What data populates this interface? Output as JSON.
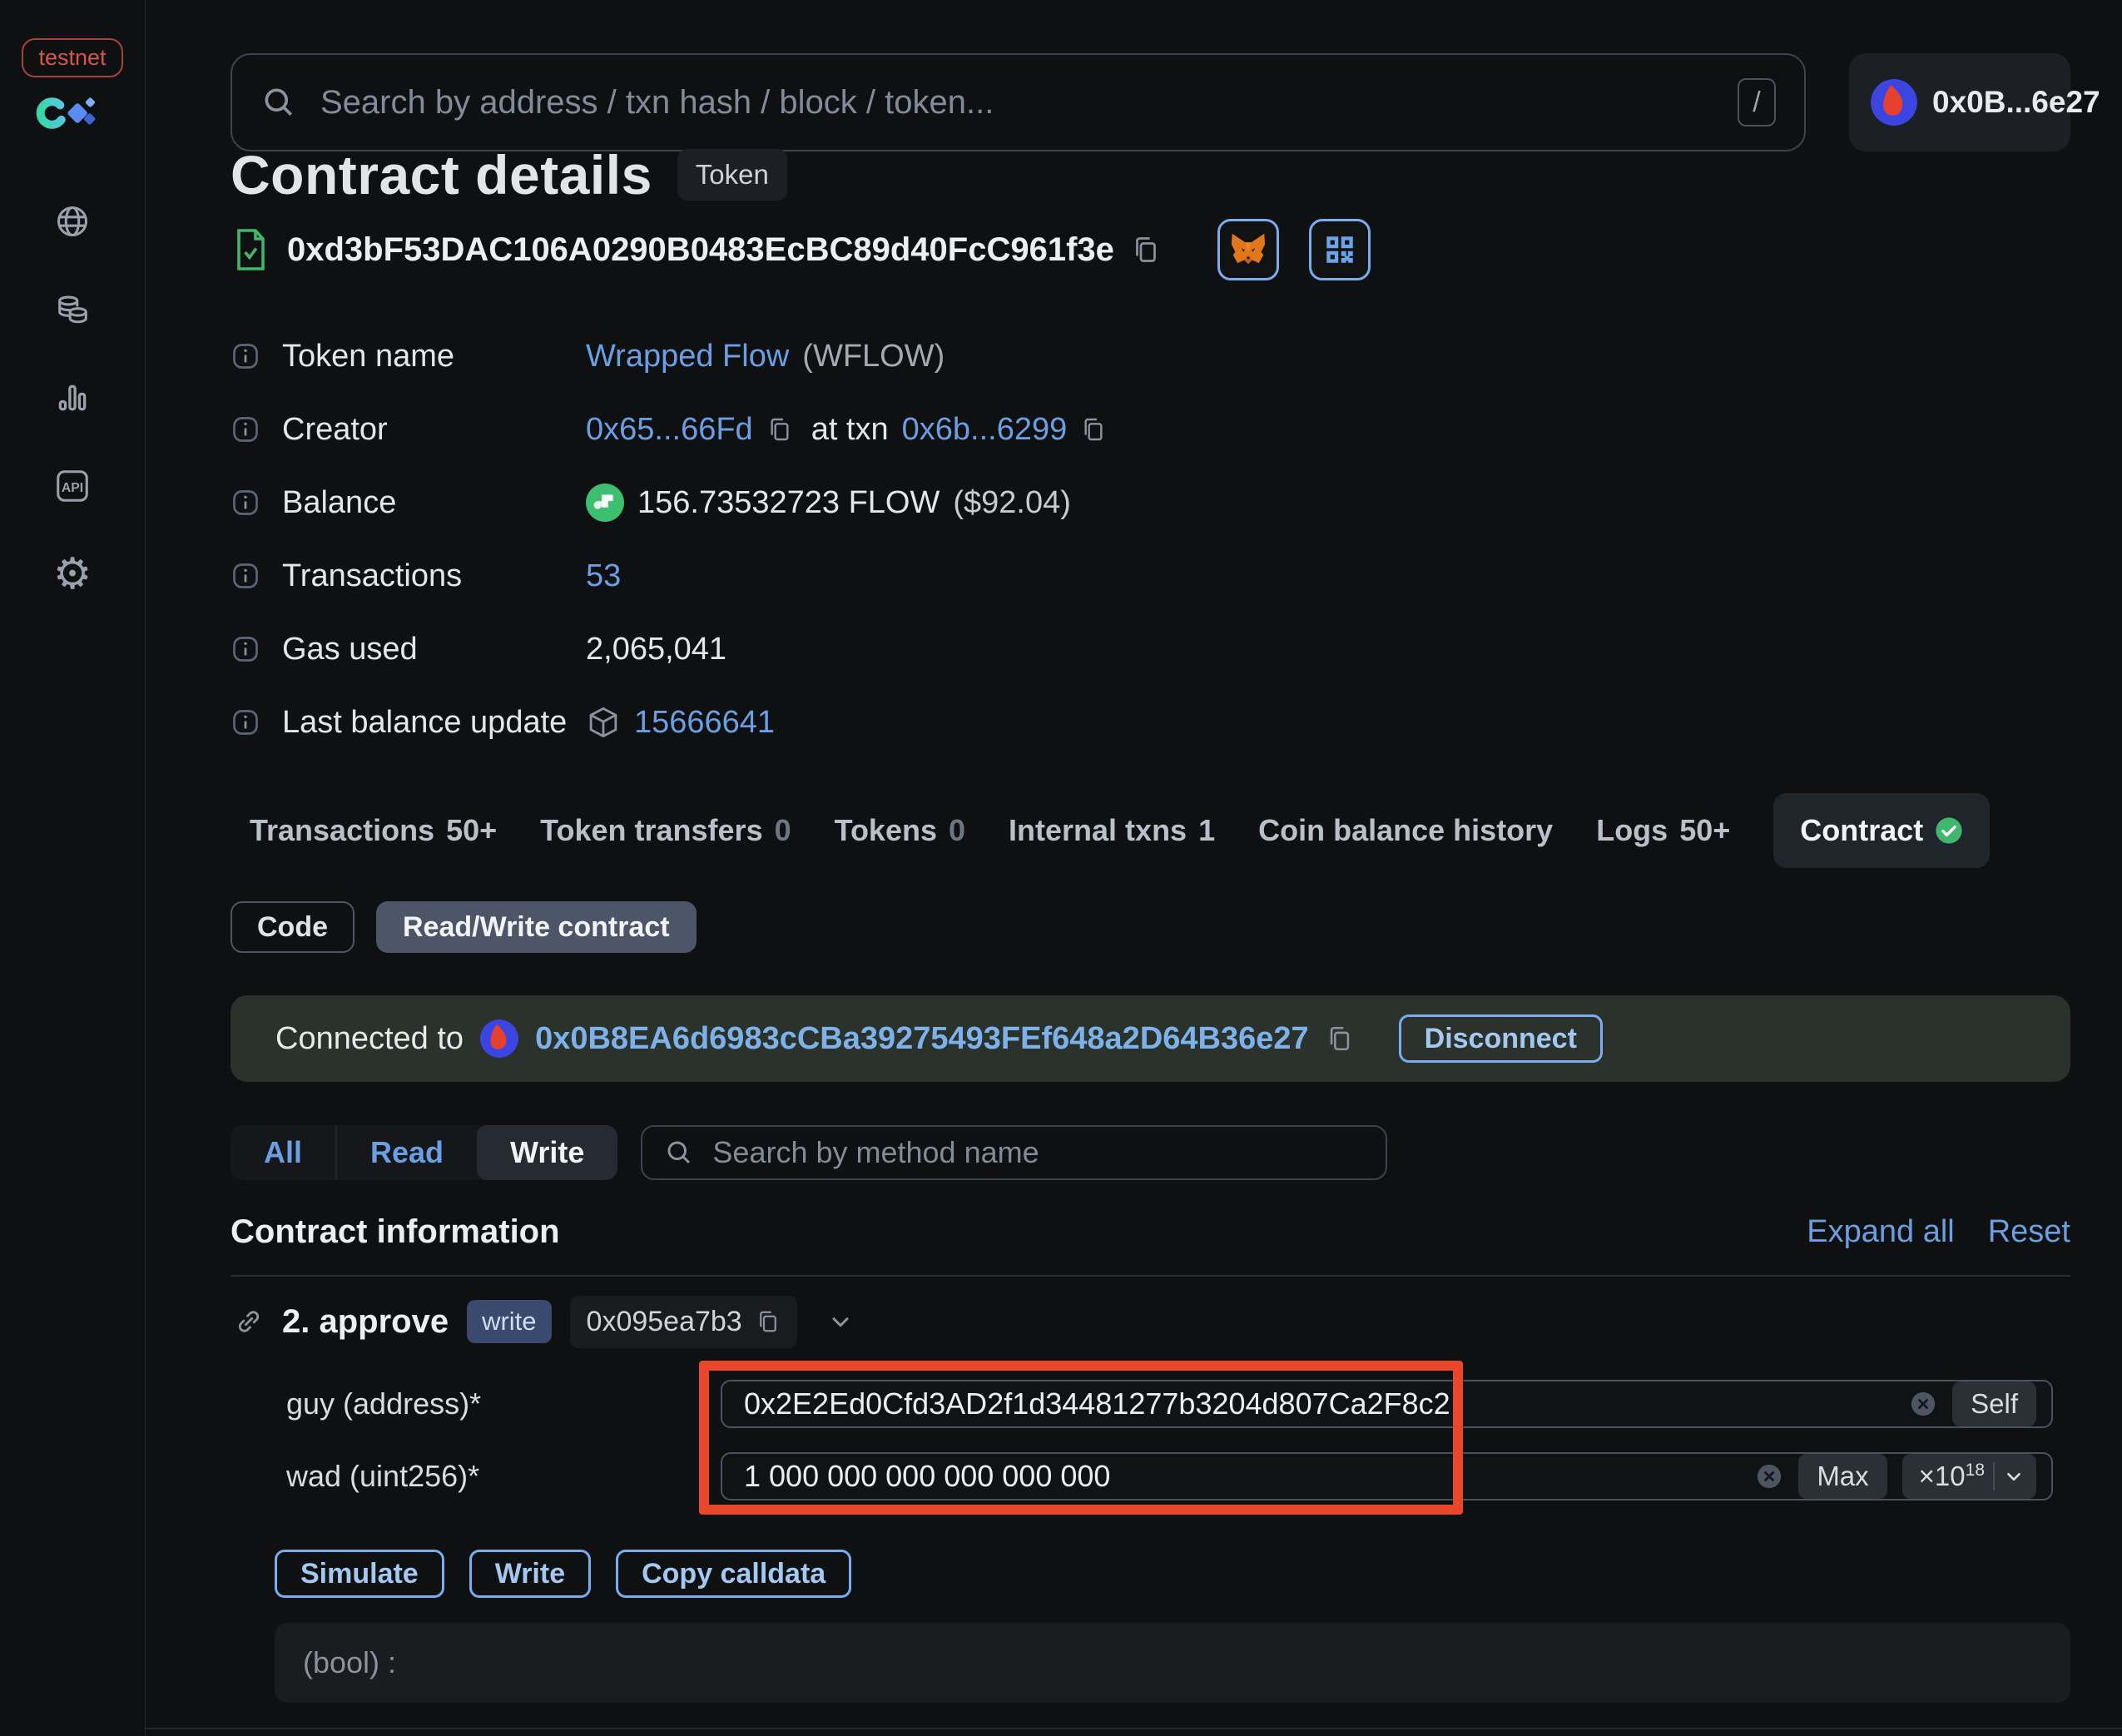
{
  "colors": {
    "accent_blue": "#77aef0",
    "link_blue": "#6b9fe4",
    "success_green": "#3fb76c",
    "annotation_red": "#e8472c",
    "banner_green": "#2a322b"
  },
  "sidebar": {
    "network_badge": "testnet",
    "icons": [
      "flow-logo",
      "globe-icon",
      "tokens-icon",
      "stats-icon",
      "api-icon",
      "gear-icon"
    ]
  },
  "header": {
    "search_placeholder": "Search by address / txn hash / block / token...",
    "search_shortcut": "/",
    "wallet_label": "0x0B...6e27"
  },
  "page": {
    "title": "Contract details",
    "type_badge": "Token",
    "contract_address": "0xd3bF53DAC106A0290B0483EcBC89d40FcC961f3e"
  },
  "info": {
    "token_name": {
      "label": "Token name",
      "value_link": "Wrapped Flow",
      "value_suffix": "(WFLOW)"
    },
    "creator": {
      "label": "Creator",
      "creator_address": "0x65...66Fd",
      "middle_text": "at txn",
      "txn_hash": "0x6b...6299"
    },
    "balance": {
      "label": "Balance",
      "value": "156.73532723 FLOW",
      "usd": "($92.04)"
    },
    "transactions": {
      "label": "Transactions",
      "value": "53"
    },
    "gas_used": {
      "label": "Gas used",
      "value": "2,065,041"
    },
    "last_balance_update": {
      "label": "Last balance update",
      "value": "15666641"
    }
  },
  "tabs": [
    {
      "label": "Transactions",
      "count": "50+"
    },
    {
      "label": "Token transfers",
      "count": "0"
    },
    {
      "label": "Tokens",
      "count": "0"
    },
    {
      "label": "Internal txns",
      "count": "1"
    },
    {
      "label": "Coin balance history",
      "count": ""
    },
    {
      "label": "Logs",
      "count": "50+"
    },
    {
      "label": "Contract",
      "count": ""
    }
  ],
  "contract_tabs": {
    "code": "Code",
    "read_write": "Read/Write contract"
  },
  "connection": {
    "prefix": "Connected to",
    "address": "0x0B8EA6d6983cCBa39275493FEf648a2D64B36e27",
    "disconnect": "Disconnect"
  },
  "methods_toolbar": {
    "filter_all": "All",
    "filter_read": "Read",
    "filter_write": "Write",
    "search_placeholder": "Search by method name"
  },
  "section": {
    "heading": "Contract information",
    "expand_all": "Expand all",
    "reset": "Reset"
  },
  "method": {
    "title": "2. approve",
    "type_badge": "write",
    "selector": "0x095ea7b3",
    "fields": {
      "guy": {
        "label": "guy (address)*",
        "value": "0x2E2Ed0Cfd3AD2f1d34481277b3204d807Ca2F8c2",
        "action": "Self"
      },
      "wad": {
        "label": "wad (uint256)*",
        "value": "1 000 000 000 000 000 000",
        "action_max": "Max",
        "multiplier_base": "×10",
        "multiplier_exp": "18"
      }
    },
    "actions": {
      "simulate": "Simulate",
      "write": "Write",
      "copy": "Copy calldata"
    },
    "output": "(bool) :"
  }
}
